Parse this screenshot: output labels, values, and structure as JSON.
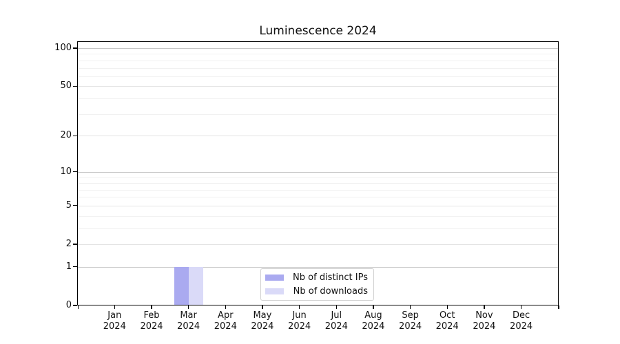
{
  "title": "Luminescence 2024",
  "legend": {
    "items": [
      {
        "label": "Nb of distinct IPs",
        "color": "#aaaaf0"
      },
      {
        "label": "Nb of downloads",
        "color": "#dadaf8"
      }
    ]
  },
  "chart_data": {
    "type": "bar",
    "title": "Luminescence 2024",
    "categories": [
      "Jan",
      "Feb",
      "Mar",
      "Apr",
      "May",
      "Jun",
      "Jul",
      "Aug",
      "Sep",
      "Oct",
      "Nov",
      "Dec"
    ],
    "x_year_label": "2024",
    "series": [
      {
        "name": "Nb of distinct IPs",
        "color": "#aaaaf0",
        "values": [
          0,
          0,
          1,
          0,
          0,
          0,
          0,
          0,
          0,
          0,
          0,
          0
        ]
      },
      {
        "name": "Nb of downloads",
        "color": "#dadaf8",
        "values": [
          0,
          0,
          1,
          0,
          0,
          0,
          0,
          0,
          0,
          0,
          0,
          0
        ]
      }
    ],
    "y_scale": "log1p",
    "y_ticks": [
      0,
      1,
      2,
      5,
      10,
      20,
      50,
      100
    ],
    "y_minor_ticks": [
      3,
      4,
      6,
      7,
      8,
      9,
      30,
      40,
      60,
      70,
      80,
      90
    ],
    "y_emphasized_ticks": [
      1,
      10,
      100
    ],
    "ylim": [
      0,
      112
    ],
    "xlabel": "",
    "ylabel": "",
    "grid": "on",
    "legend_position": "bottom-center"
  }
}
